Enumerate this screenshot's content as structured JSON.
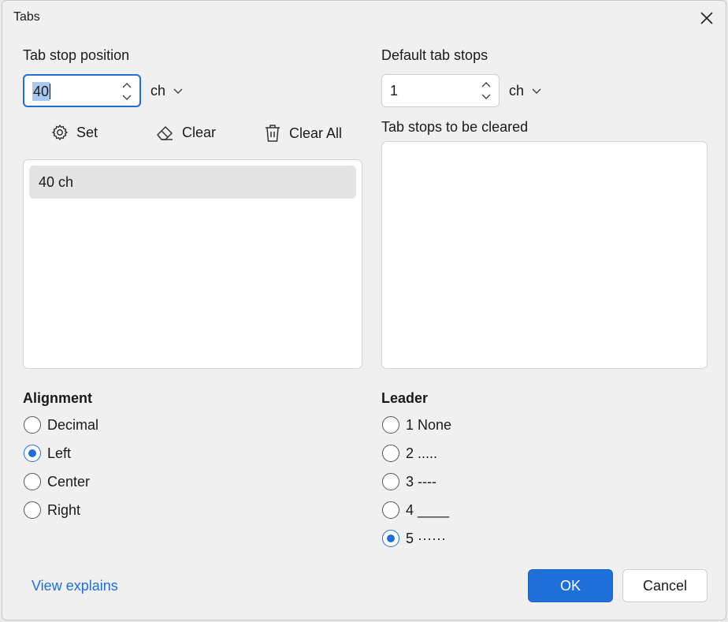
{
  "window": {
    "title": "Tabs"
  },
  "tab_stop_position": {
    "label": "Tab stop position",
    "value": "40",
    "unit": "ch"
  },
  "default_tab_stops": {
    "label": "Default tab stops",
    "value": "1",
    "unit": "ch"
  },
  "actions": {
    "set_label": "Set",
    "clear_label": "Clear",
    "clear_all_label": "Clear All"
  },
  "tab_stops_list": {
    "items": [
      "40 ch"
    ]
  },
  "cleared_list": {
    "label": "Tab stops to be cleared"
  },
  "alignment": {
    "label": "Alignment",
    "options": [
      "Decimal",
      "Left",
      "Center",
      "Right"
    ],
    "selected": "Left"
  },
  "leader": {
    "label": "Leader",
    "options": [
      "1 None",
      "2 .....",
      "3 ----",
      "4 ____",
      "5 ······"
    ],
    "selected": "5 ······"
  },
  "footer": {
    "link_label": "View explains",
    "ok_label": "OK",
    "cancel_label": "Cancel"
  },
  "colors": {
    "accent": "#1f6fd8",
    "background": "#f0f0f0"
  }
}
